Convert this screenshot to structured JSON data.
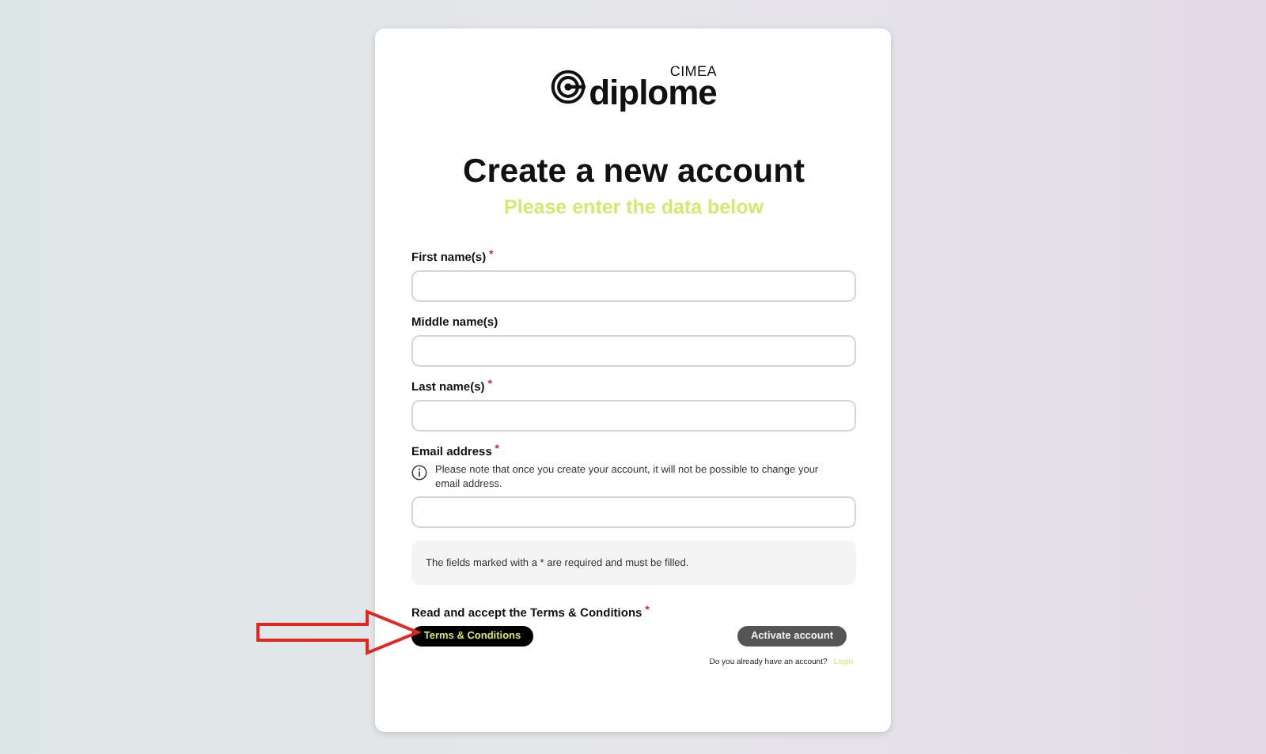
{
  "logo": {
    "brand": "diplome",
    "tag": "CIMEA"
  },
  "required_mark": "*",
  "title": "Create a new account",
  "subtitle": "Please enter the data below",
  "fields": [
    {
      "label": "First name(s)",
      "required": true
    },
    {
      "label": "Middle name(s)",
      "required": false
    },
    {
      "label": "Last name(s)",
      "required": true
    },
    {
      "label": "Email address",
      "required": true,
      "note": "Please note that once you create your account, it will not be possible to change your email address."
    }
  ],
  "required_notice": "The fields marked with a * are required and must be filled.",
  "terms": {
    "label": "Read and accept the Terms & Conditions",
    "required": true,
    "button": "Terms & Conditions"
  },
  "activate_button": {
    "label": "Activate account",
    "disabled": true
  },
  "login_prompt": {
    "text": "Do you already have an account?",
    "link": "Login"
  }
}
